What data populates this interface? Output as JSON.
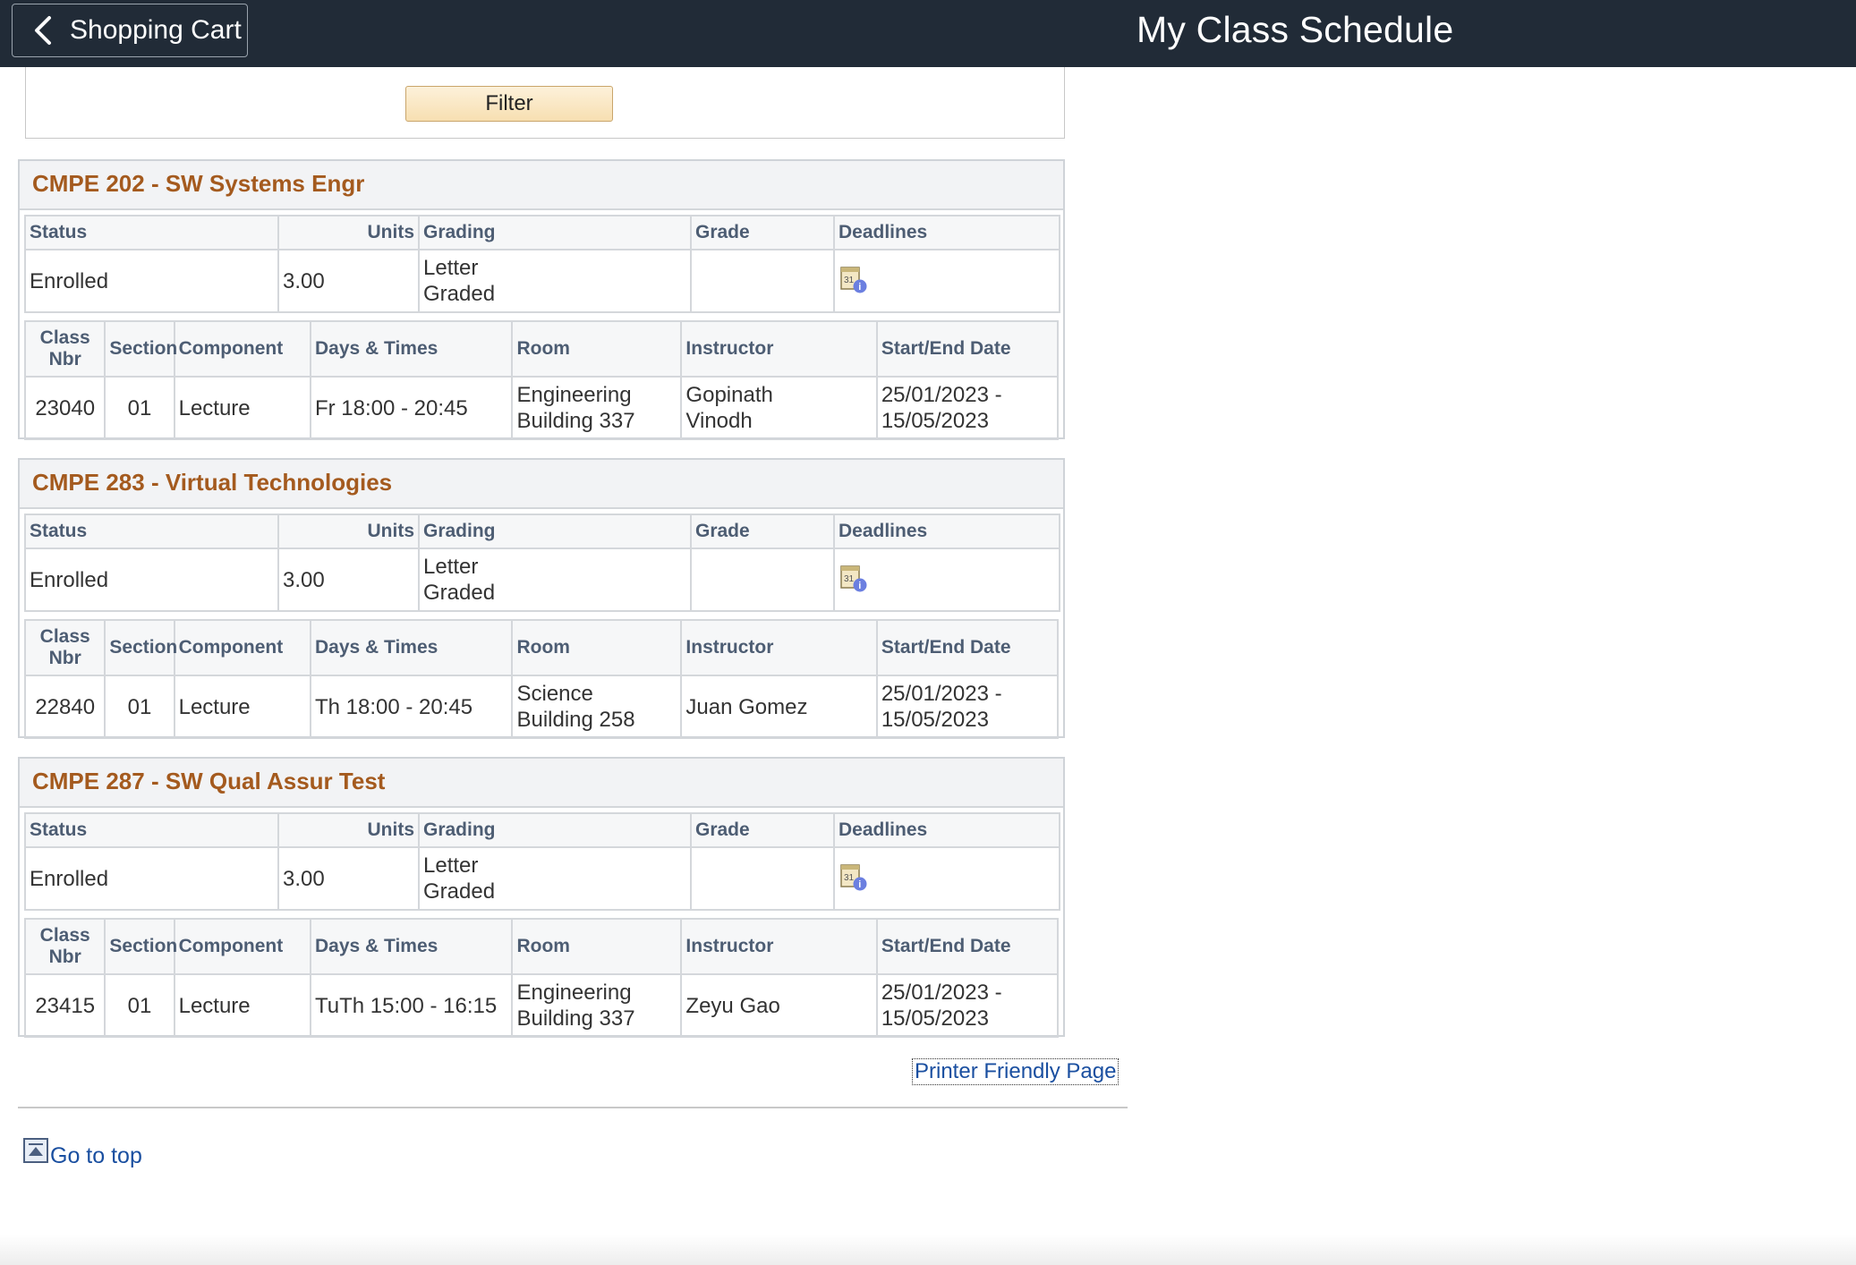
{
  "header": {
    "back_label": "Shopping Cart",
    "title": "My Class Schedule"
  },
  "filter": {
    "label": "Filter"
  },
  "course_headers": {
    "status": "Status",
    "units": "Units",
    "grading": "Grading",
    "grade": "Grade",
    "deadlines": "Deadlines",
    "class_nbr_1": "Class",
    "class_nbr_2": "Nbr",
    "section": "Section",
    "component": "Component",
    "days_times": "Days & Times",
    "room": "Room",
    "instructor": "Instructor",
    "dates": "Start/End Date"
  },
  "courses": [
    {
      "title": "CMPE 202 - SW Systems Engr",
      "status": "Enrolled",
      "units": "3.00",
      "grading_1": "Letter",
      "grading_2": "Graded",
      "grade": "",
      "class_nbr": "23040",
      "section": "01",
      "component": "Lecture",
      "days_times": "Fr 18:00 - 20:45",
      "room_1": "Engineering",
      "room_2": "Building 337",
      "instructor_1": "Gopinath",
      "instructor_2": "Vinodh",
      "date_1": "25/01/2023 -",
      "date_2": "15/05/2023"
    },
    {
      "title": "CMPE 283 - Virtual Technologies",
      "status": "Enrolled",
      "units": "3.00",
      "grading_1": "Letter",
      "grading_2": "Graded",
      "grade": "",
      "class_nbr": "22840",
      "section": "01",
      "component": "Lecture",
      "days_times": "Th 18:00 - 20:45",
      "room_1": "Science",
      "room_2": "Building 258",
      "instructor_1": "Juan Gomez",
      "instructor_2": "",
      "date_1": "25/01/2023 -",
      "date_2": "15/05/2023"
    },
    {
      "title": "CMPE 287 - SW Qual Assur Test",
      "status": "Enrolled",
      "units": "3.00",
      "grading_1": "Letter",
      "grading_2": "Graded",
      "grade": "",
      "class_nbr": "23415",
      "section": "01",
      "component": "Lecture",
      "days_times": "TuTh 15:00 - 16:15",
      "room_1": "Engineering",
      "room_2": "Building 337",
      "instructor_1": "Zeyu Gao",
      "instructor_2": "",
      "date_1": "25/01/2023 -",
      "date_2": "15/05/2023"
    }
  ],
  "footer": {
    "printer_label": "Printer Friendly Page",
    "go_top_label": "Go to top"
  },
  "icons": {
    "back": "chevron-left-icon",
    "deadline": "calendar-info-icon",
    "go_top": "arrow-up-box-icon"
  },
  "colors": {
    "topbar": "#212b37",
    "course_title": "#a45a1e",
    "header_text": "#4d5d73",
    "link": "#1a4fa0"
  }
}
